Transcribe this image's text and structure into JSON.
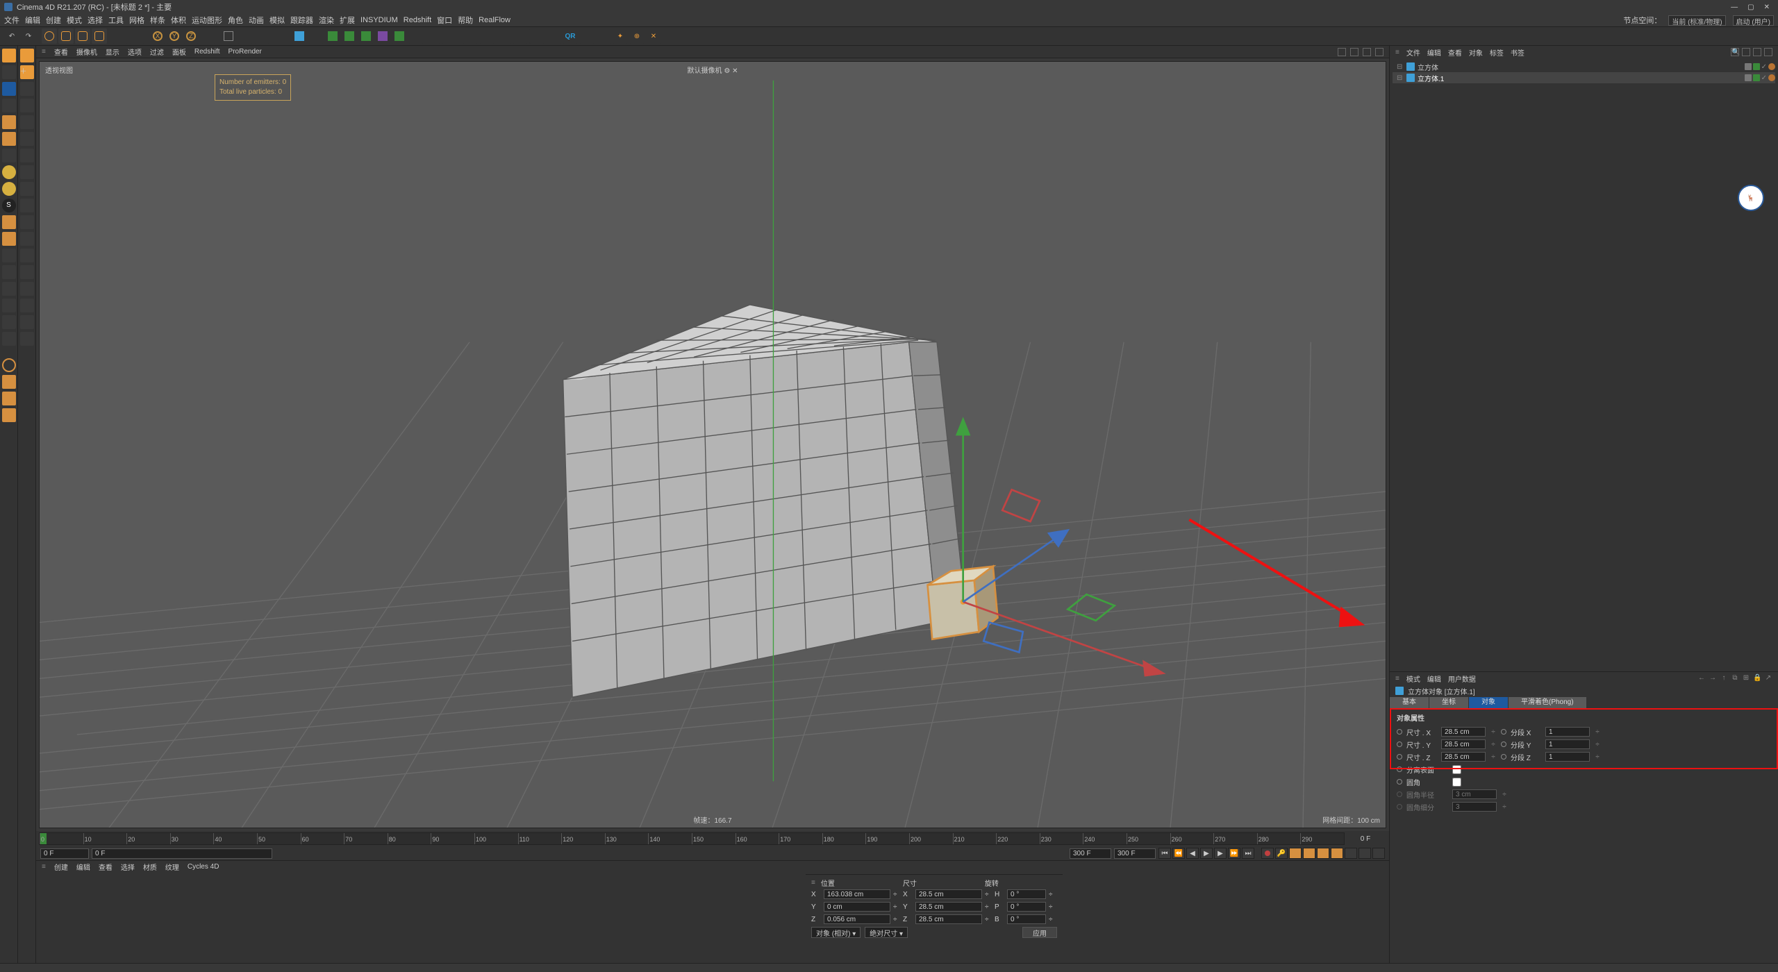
{
  "title": "Cinema 4D R21.207 (RC) - [未标题 2 *] - 主要",
  "win": {
    "min": "—",
    "max": "▢",
    "close": "✕"
  },
  "menu": [
    "文件",
    "编辑",
    "创建",
    "模式",
    "选择",
    "工具",
    "网格",
    "样条",
    "体积",
    "运动图形",
    "角色",
    "动画",
    "模拟",
    "跟踪器",
    "渲染",
    "扩展",
    "INSYDIUM",
    "Redshift",
    "窗口",
    "帮助",
    "RealFlow"
  ],
  "menu_right": {
    "lbl": "节点空间：",
    "opt1": "当前 (标准/物理)",
    "lbl2": "启动 (用户)"
  },
  "vp_menu": [
    "查看",
    "摄像机",
    "显示",
    "选项",
    "过滤",
    "面板",
    "Redshift",
    "ProRender"
  ],
  "vp": {
    "label": "透视视图",
    "cam": "默认摄像机",
    "hud1": "Number of emitters: 0",
    "hud2": "Total live particles: 0",
    "speed": "帧速：166.7",
    "grid": "网格间距：100 cm"
  },
  "timeline": {
    "start": 0,
    "end": 300,
    "tick_step": 10,
    "disp_end": "300 F",
    "proj_end": "300 F",
    "cur": "0 F",
    "rstart": "0 F"
  },
  "mat_tabs": [
    "创建",
    "编辑",
    "查看",
    "选择",
    "材质",
    "纹理",
    "Cycles 4D"
  ],
  "omgr_menu": [
    "文件",
    "编辑",
    "查看",
    "对象",
    "标签",
    "书签"
  ],
  "objects": [
    {
      "name": "立方体",
      "sel": false
    },
    {
      "name": "立方体.1",
      "sel": true
    }
  ],
  "attr_menu": [
    "模式",
    "编辑",
    "用户数据"
  ],
  "attr_obj": "立方体对象 [立方体.1]",
  "attr_tabs": [
    "基本",
    "坐标",
    "对象",
    "平滑着色(Phong)"
  ],
  "attr_active": 2,
  "props_title": "对象属性",
  "size": {
    "x": "28.5 cm",
    "y": "28.5 cm",
    "z": "28.5 cm"
  },
  "seg": {
    "x": "1",
    "y": "1",
    "z": "1"
  },
  "labels": {
    "size": "尺寸",
    "seg": "分段",
    "sepsurf": "分离表面",
    "fillet": "圆角",
    "fillet_r": "圆角半径",
    "fillet_r_v": "3 cm",
    "fillet_s": "圆角细分",
    "fillet_s_v": "3"
  },
  "coords_head": [
    "位置",
    "尺寸",
    "旋转"
  ],
  "coords": {
    "X": {
      "p": "163.038 cm",
      "s": "28.5 cm",
      "r_lbl": "H",
      "r": "0 °"
    },
    "Y": {
      "p": "0 cm",
      "s": "28.5 cm",
      "r_lbl": "P",
      "r": "0 °"
    },
    "Z": {
      "p": "0.056 cm",
      "s": "28.5 cm",
      "r_lbl": "B",
      "r": "0 °"
    }
  },
  "coord_sel": [
    "对象 (相对)",
    "绝对尺寸"
  ],
  "apply": "应用",
  "axis_badge": {
    "x": "x",
    "y": "y",
    "z": "z"
  }
}
